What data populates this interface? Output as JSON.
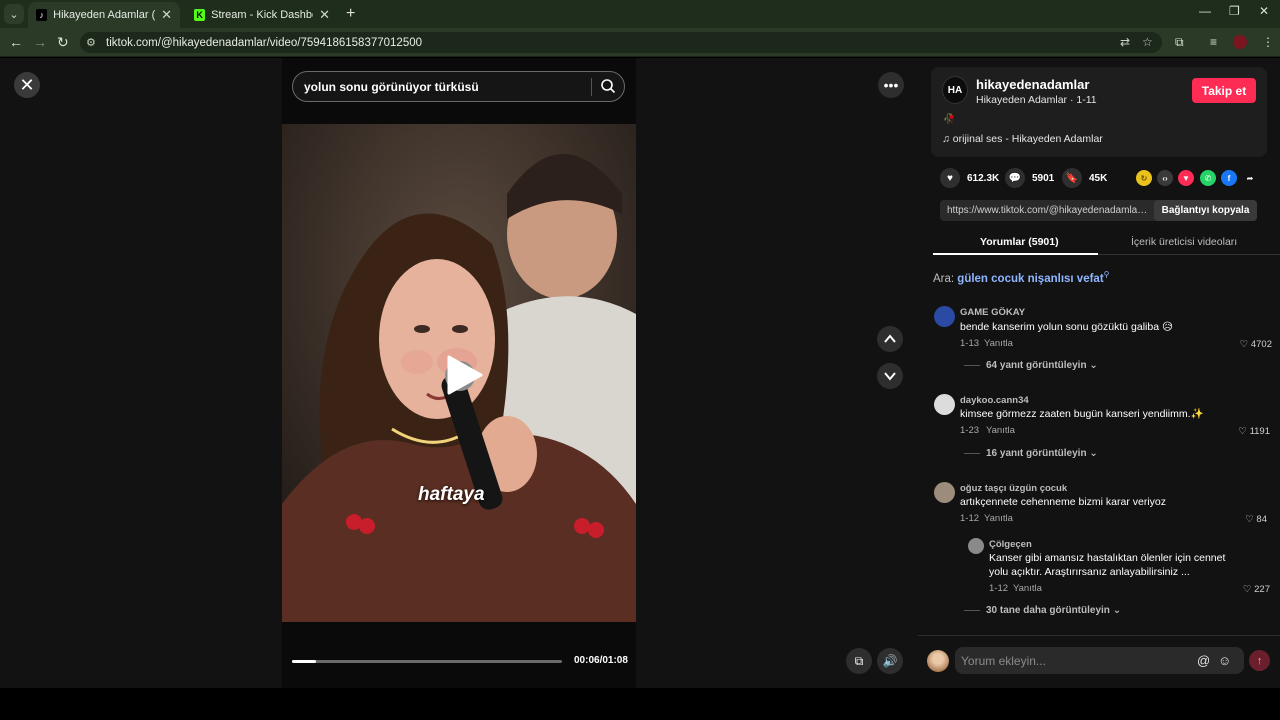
{
  "browser": {
    "tabs": [
      {
        "title": "Hikayeden Adamlar (@hikayedenadamlar)",
        "active": true,
        "favicon": "tiktok-icon"
      },
      {
        "title": "Stream - Kick Dashboard",
        "active": false,
        "favicon": "kick-icon"
      }
    ],
    "url": "tiktok.com/@hikayedenadamlar/video/7594186158377012500",
    "colors": {
      "tabbar": "#1f2d1c",
      "toolbar": "#2b3a27"
    }
  },
  "video": {
    "search_query": "yolun sonu görünüyor türküsü",
    "caption": "haftaya",
    "time": "00:06/01:08",
    "progress_fraction": 0.09
  },
  "author": {
    "avatar_text": "HA",
    "handle": "hikayedenadamlar",
    "subtitle": "Hikayeden Adamlar · 1-11",
    "follow_label": "Takip et",
    "music": "orijinal ses - Hikayeden Adamlar"
  },
  "stats": {
    "likes": "612.3K",
    "comments": "5901",
    "saves": "45K"
  },
  "share": {
    "link": "https://www.tiktok.com/@hikayedenadamlar/...",
    "copy_label": "Bağlantıyı kopyala"
  },
  "panel_tabs": {
    "comments": "Yorumlar (5901)",
    "creator_videos": "İçerik üreticisi videoları"
  },
  "search_suggestion": {
    "prefix": "Ara:",
    "keyword": "gülen cocuk nişanlısı vefat"
  },
  "comments": [
    {
      "user": "GAME GÖKAY",
      "text": "bende kanserim yolun sonu gözüktü galiba 😥",
      "date": "1-13",
      "reply_label": "Yanıtla",
      "likes": "4702",
      "replies": "64 yanıt görüntüleyin"
    },
    {
      "user": "daykoo.cann34",
      "text": "kimsee görmezz zaaten bugün kanseri yendiimm.✨",
      "date": "1-23",
      "reply_label": "Yanıtla",
      "likes": "1191",
      "replies": "16 yanıt görüntüleyin"
    },
    {
      "user": "oğuz taşçı üzgün çocuk",
      "text": "artıkçennete cehenneme bizmi karar veriyoz",
      "date": "1-12",
      "reply_label": "Yanıtla",
      "likes": "84",
      "replies": "30 tane daha görüntüleyin"
    }
  ],
  "nested_reply": {
    "user": "Çölgeçen",
    "text_line1": "Kanser gibi amansız hastalıktan ölenler için cennet",
    "text_line2": "yolu açıktır. Araştırırsanız anlayabilirsiniz ...",
    "date": "1-12",
    "reply_label": "Yanıtla",
    "likes": "227"
  },
  "comment_input": {
    "placeholder": "Yorum ekleyin..."
  }
}
